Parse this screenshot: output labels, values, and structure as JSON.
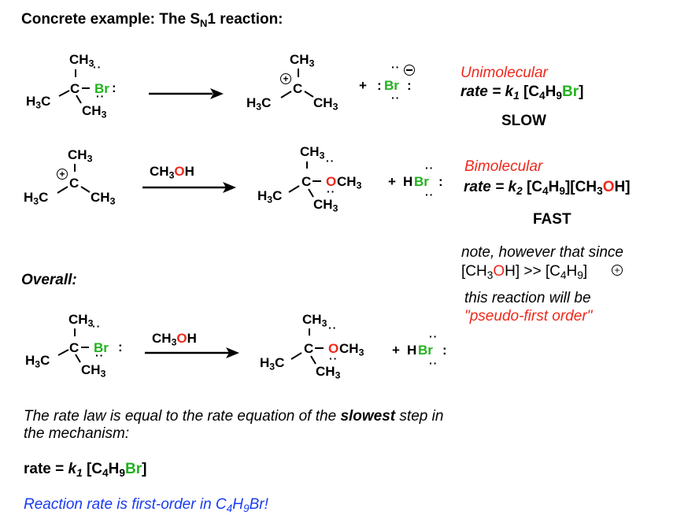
{
  "title": {
    "prefix": "Concrete example: The S",
    "sub": "N",
    "suffix": "1 reaction:"
  },
  "atoms": {
    "ch3": "CH",
    "three": "3",
    "h3c_h": "H",
    "h3c_c": "C",
    "c": "C",
    "br": "Br",
    "o": "O",
    "colon": ":",
    "plus": "+",
    "h": "H",
    "pair": "··"
  },
  "step1": {
    "reagent": "tert-butyl bromide",
    "products": [
      "tert-butyl carbocation",
      "bromide anion"
    ],
    "label": "Unimolecular",
    "rate_prefix": "rate = ",
    "rate_k": "k",
    "rate_k_sub": "1",
    "rate_open": " [C",
    "rate_c_sub": "4",
    "rate_h": "H",
    "rate_h_sub": "9",
    "rate_br": "Br",
    "rate_close": "]",
    "speed": "SLOW"
  },
  "step2": {
    "reagent_above_arrow": {
      "ch": "CH",
      "sub": "3",
      "o": "O",
      "h": "H"
    },
    "label": "Bimolecular",
    "rate_prefix": "rate = ",
    "rate_k": "k",
    "rate_k_sub": "2",
    "rate_open": " [C",
    "rate_c_sub": "4",
    "rate_h": "H",
    "rate_h_sub": "9",
    "rate_mid": "][CH",
    "rate_ch_sub": "3",
    "rate_o": "O",
    "rate_close": "H]",
    "speed": "FAST"
  },
  "note": {
    "line1": "note, however that since",
    "line2_open": "[CH",
    "line2_sub1": "3",
    "line2_o": "O",
    "line2_mid": "H] >> [C",
    "line2_sub2": "4",
    "line2_h": "H",
    "line2_sub3": "9",
    "line2_close": "]",
    "line3": "this reaction will be",
    "line4": "\"pseudo-first order\""
  },
  "overall": {
    "heading": "Overall:",
    "reagent_above_arrow": {
      "ch": "CH",
      "sub": "3",
      "o": "O",
      "h": "H"
    }
  },
  "conclusion": {
    "line1_pre": "The rate law is equal to the rate equation of the ",
    "line1_bold": "slowest",
    "line1_post": " step in",
    "line2": "the mechanism:",
    "rate_prefix": "rate = ",
    "rate_k": "k",
    "rate_k_sub": "1",
    "rate_open": " [C",
    "rate_c_sub": "4",
    "rate_h": "H",
    "rate_h_sub": "9",
    "rate_br": "Br",
    "rate_close": "]",
    "final_pre": "Reaction rate is first-order in C",
    "final_sub1": "4",
    "final_h": "H",
    "final_sub2": "9",
    "final_post": "Br!"
  },
  "colors": {
    "bromine": "#22b21e",
    "oxygen": "#f0281c",
    "label": "#f0281c",
    "conclusion": "#1a3cf0"
  }
}
